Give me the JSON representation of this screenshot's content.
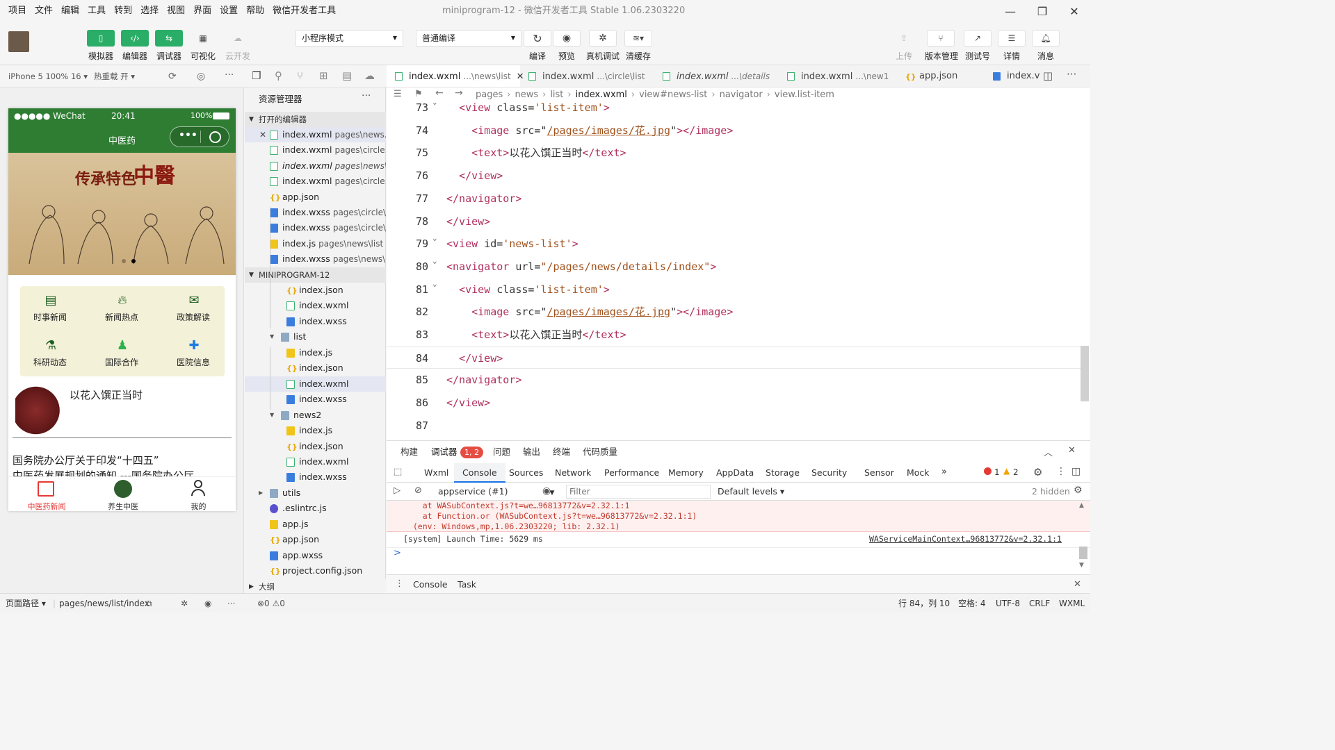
{
  "menu": [
    "项目",
    "文件",
    "编辑",
    "工具",
    "转到",
    "选择",
    "视图",
    "界面",
    "设置",
    "帮助",
    "微信开发者工具"
  ],
  "window_title": "miniprogram-12 - 微信开发者工具 Stable 1.06.2303220",
  "toolbar": {
    "simulator": "模拟器",
    "editor": "编辑器",
    "debugger": "调试器",
    "visual": "可视化",
    "cloud": "云开发",
    "mode": "小程序模式",
    "compile_mode": "普通编译",
    "compile": "编译",
    "preview": "预览",
    "remote_debug": "真机调试",
    "clear_cache": "清缓存",
    "upload": "上传",
    "version": "版本管理",
    "test_id": "测试号",
    "details": "详情",
    "messages": "消息"
  },
  "subbar": {
    "device": "iPhone 5 100% 16",
    "hot_reload": "热重载 开"
  },
  "phone": {
    "carrier": "●●●●● WeChat",
    "time": "20:41",
    "battery": "100%",
    "nav_title": "中医药",
    "banner_title": "传承特色",
    "banner_char": "中醫",
    "grid": [
      "时事新闻",
      "新闻热点",
      "政策解读",
      "科研动态",
      "国际合作",
      "医院信息"
    ],
    "news1_title": "以花入馔正当时",
    "news2_title": "国务院办公厅关于印发“十四五”",
    "news2_line2": "中医药发展规划的通知 ---国务院办公厅",
    "tabbar": [
      "中医药新闻",
      "养生中医",
      "我的"
    ]
  },
  "explorer": {
    "title": "资源管理器",
    "open_editors_header": "打开的编辑器",
    "open_editors": [
      {
        "name": "index.wxml",
        "path": "pages\\news...",
        "type": "wxml"
      },
      {
        "name": "index.wxml",
        "path": "pages\\circle...",
        "type": "wxml"
      },
      {
        "name": "index.wxml",
        "path": "pages\\news\\...",
        "type": "wxml"
      },
      {
        "name": "index.wxml",
        "path": "pages\\circle...",
        "type": "wxml"
      },
      {
        "name": "app.json",
        "path": "",
        "type": "json"
      },
      {
        "name": "index.wxss",
        "path": "pages\\circle\\...",
        "type": "wxss"
      },
      {
        "name": "index.wxss",
        "path": "pages\\circle\\...",
        "type": "wxss"
      },
      {
        "name": "index.js",
        "path": "pages\\news\\list",
        "type": "js"
      },
      {
        "name": "index.wxss",
        "path": "pages\\news\\...",
        "type": "wxss"
      }
    ],
    "project_header": "MINIPROGRAM-12",
    "tree": [
      {
        "name": "index.json",
        "type": "json",
        "indent": 60
      },
      {
        "name": "index.wxml",
        "type": "wxml",
        "indent": 60
      },
      {
        "name": "index.wxss",
        "type": "wxss",
        "indent": 60
      },
      {
        "name": "list",
        "type": "folder",
        "indent": 52
      },
      {
        "name": "index.js",
        "type": "js",
        "indent": 60
      },
      {
        "name": "index.json",
        "type": "json",
        "indent": 60
      },
      {
        "name": "index.wxml",
        "type": "wxml",
        "indent": 60
      },
      {
        "name": "index.wxss",
        "type": "wxss",
        "indent": 60
      },
      {
        "name": "news2",
        "type": "folder",
        "indent": 52
      },
      {
        "name": "index.js",
        "type": "js",
        "indent": 60
      },
      {
        "name": "index.json",
        "type": "json",
        "indent": 60
      },
      {
        "name": "index.wxml",
        "type": "wxml",
        "indent": 60
      },
      {
        "name": "index.wxss",
        "type": "wxss",
        "indent": 60
      },
      {
        "name": "utils",
        "type": "folder",
        "indent": 36
      },
      {
        "name": ".eslintrc.js",
        "type": "eslint",
        "indent": 36
      },
      {
        "name": "app.js",
        "type": "js",
        "indent": 36
      },
      {
        "name": "app.json",
        "type": "json",
        "indent": 36
      },
      {
        "name": "app.wxss",
        "type": "wxss",
        "indent": 36
      },
      {
        "name": "project.config.json",
        "type": "json",
        "indent": 36
      }
    ],
    "outline": "大纲",
    "problems": "⊗0 ⚠0"
  },
  "tabs": [
    {
      "name": "index.wxml",
      "path": "...\\news\\list",
      "type": "wxml",
      "italic": false
    },
    {
      "name": "index.wxml",
      "path": "...\\circle\\list",
      "type": "wxml",
      "italic": false
    },
    {
      "name": "index.wxml",
      "path": "...\\details",
      "type": "wxml",
      "italic": true
    },
    {
      "name": "index.wxml",
      "path": "...\\new1",
      "type": "wxml",
      "italic": false
    },
    {
      "name": "app.json",
      "path": "",
      "type": "json",
      "italic": false
    },
    {
      "name": "index.v",
      "path": "",
      "type": "wxss",
      "italic": false
    }
  ],
  "breadcrumb": [
    "pages",
    "news",
    "list",
    "index.wxml",
    "view#news-list",
    "navigator",
    "view.list-item"
  ],
  "code_lines": [
    {
      "n": "73",
      "html": "  <span class=t>&lt;view</span> <span class=a>class=</span><span class=s>'list-item'</span><span class=t>&gt;</span>"
    },
    {
      "n": "74",
      "html": "    <span class=t>&lt;image</span> <span class=a>src=</span><span class=p>\"</span><span class=u>/pages/images/花.jpg</span><span class=p>\"</span><span class=t>&gt;&lt;/image&gt;</span>"
    },
    {
      "n": "75",
      "html": "    <span class=t>&lt;text&gt;</span>以花入馔正当时<span class=t>&lt;/text&gt;</span>"
    },
    {
      "n": "76",
      "html": "  <span class=t>&lt;/view&gt;</span>"
    },
    {
      "n": "77",
      "html": "<span class=t>&lt;/navigator&gt;</span>"
    },
    {
      "n": "78",
      "html": "<span class=t>&lt;/view&gt;</span>"
    },
    {
      "n": "79",
      "html": "<span class=t>&lt;view</span> <span class=a>id=</span><span class=s>'news-list'</span><span class=t>&gt;</span>"
    },
    {
      "n": "80",
      "html": "<span class=t>&lt;navigator</span> <span class=a>url=</span><span class=s>\"/pages/news/details/index\"</span><span class=t>&gt;</span>"
    },
    {
      "n": "81",
      "html": "  <span class=t>&lt;view</span> <span class=a>class=</span><span class=s>'list-item'</span><span class=t>&gt;</span>"
    },
    {
      "n": "82",
      "html": "    <span class=t>&lt;image</span> <span class=a>src=</span><span class=p>\"</span><span class=u>/pages/images/花.jpg</span><span class=p>\"</span><span class=t>&gt;&lt;/image&gt;</span>"
    },
    {
      "n": "83",
      "html": "    <span class=t>&lt;text&gt;</span>以花入馔正当时<span class=t>&lt;/text&gt;</span>"
    },
    {
      "n": "84",
      "html": "  <span class=t>&lt;/view&gt;</span>"
    },
    {
      "n": "85",
      "html": "<span class=t>&lt;/navigator&gt;</span>"
    },
    {
      "n": "86",
      "html": "<span class=t>&lt;/view&gt;</span>"
    },
    {
      "n": "87",
      "html": ""
    }
  ],
  "devtools": {
    "top_tabs": [
      "构建",
      "调试器",
      "问题",
      "输出",
      "终端",
      "代码质量"
    ],
    "badge": "1, 2",
    "panel_tabs": [
      "Wxml",
      "Console",
      "Sources",
      "Network",
      "Performance",
      "Memory",
      "AppData",
      "Storage",
      "Security",
      "Sensor",
      "Mock"
    ],
    "errors": "1",
    "warnings": "2",
    "context": "appservice (#1)",
    "filter_placeholder": "Filter",
    "levels": "Default levels",
    "hidden": "2 hidden",
    "err_line1": "    at WASubContext.js?t=we…96813772&v=2.32.1:1",
    "err_line2": "    at Function.or (WASubContext.js?t=we…96813772&v=2.32.1:1)",
    "err_line3": "  (env: Windows,mp,1.06.2303220; lib: 2.32.1)",
    "log_line": "[system] Launch Time: 5629 ms",
    "log_src": "WAServiceMainContext…96813772&v=2.32.1:1",
    "prompt": ">",
    "bottom_tabs": [
      "Console",
      "Task"
    ]
  },
  "status": {
    "page_path_label": "页面路径",
    "page_path": "pages/news/list/index",
    "cursor": "行 84，列 10",
    "spaces": "空格: 4",
    "encoding": "UTF-8",
    "eol": "CRLF",
    "lang": "WXML"
  }
}
